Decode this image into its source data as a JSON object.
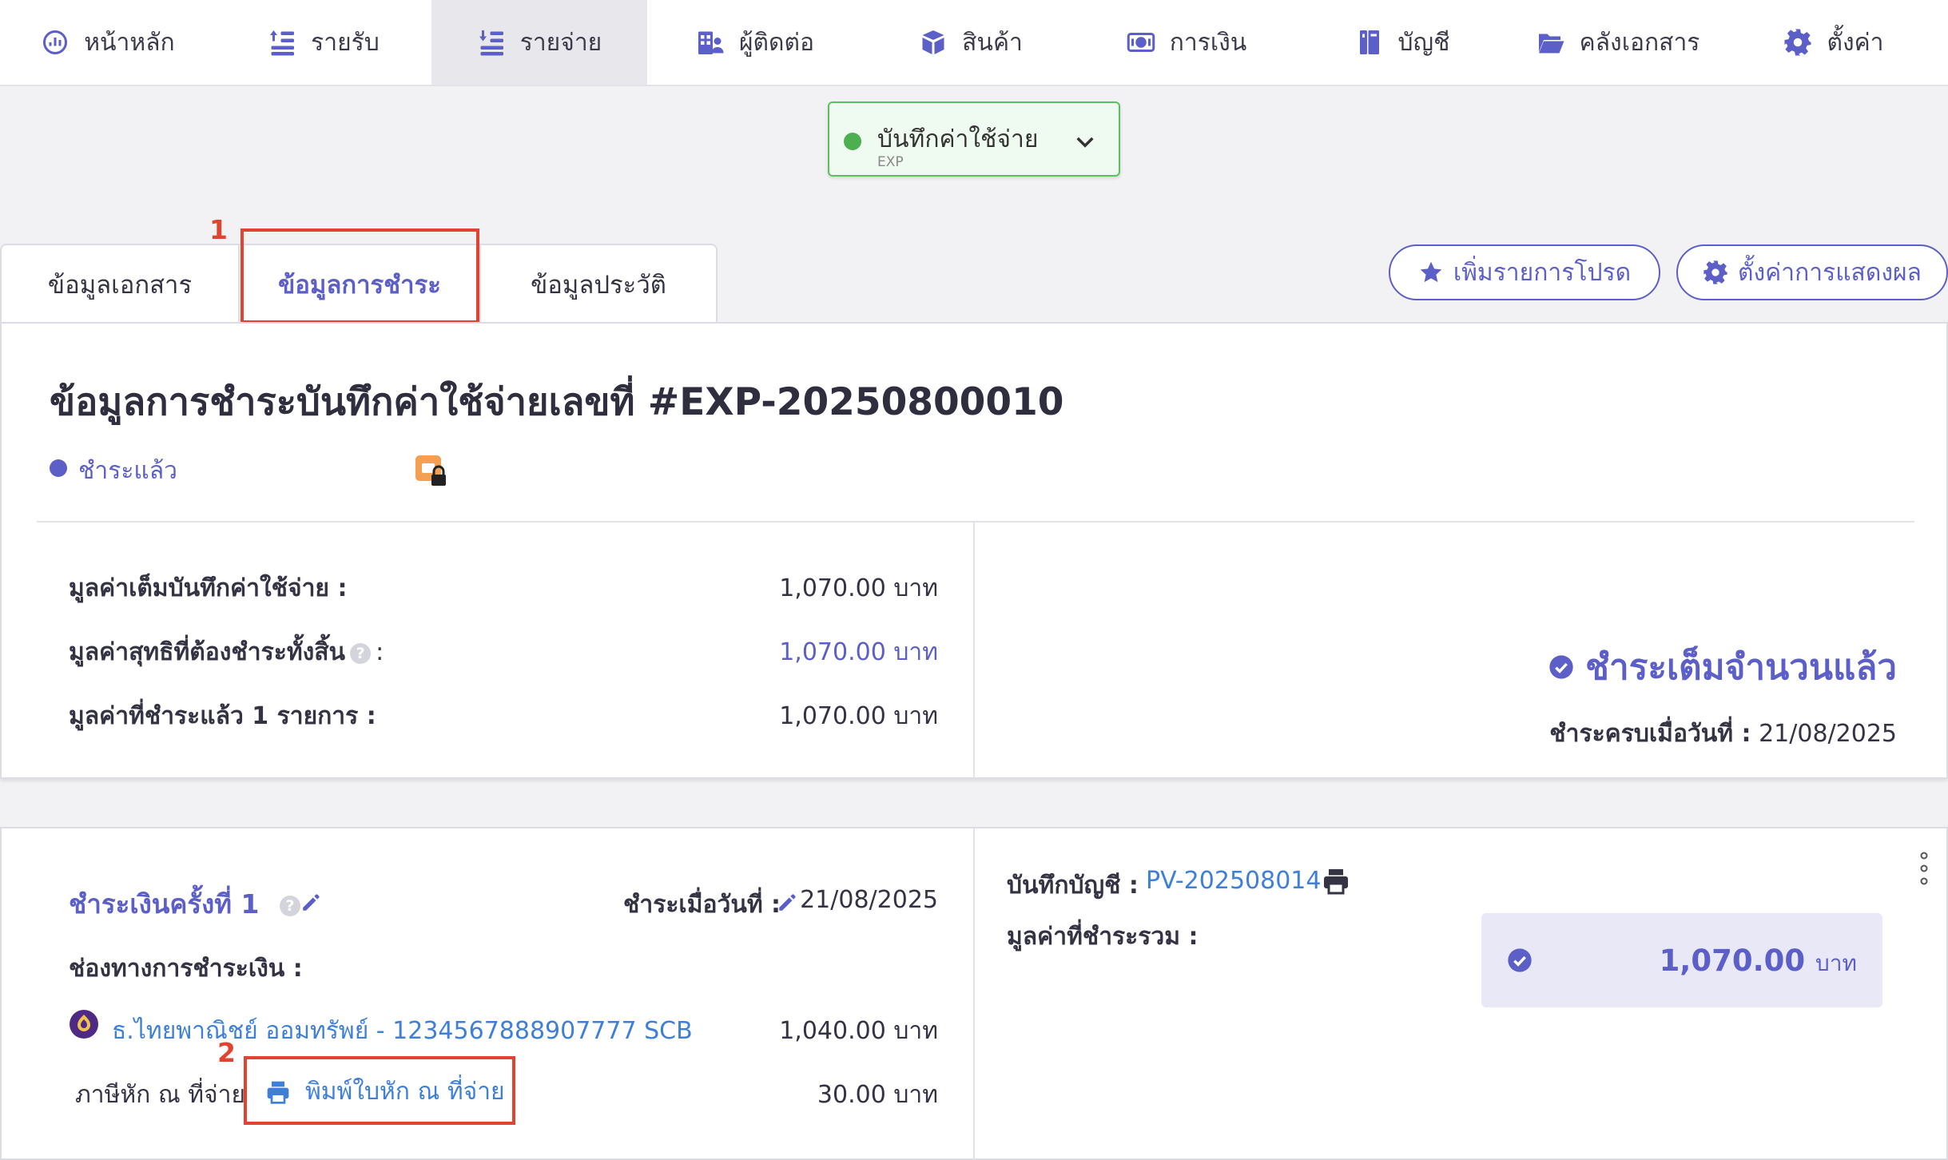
{
  "nav": {
    "items": [
      {
        "label": "หน้าหลัก",
        "icon": "dashboard-icon"
      },
      {
        "label": "รายรับ",
        "icon": "income-icon"
      },
      {
        "label": "รายจ่าย",
        "icon": "expense-icon"
      },
      {
        "label": "ผู้ติดต่อ",
        "icon": "contacts-icon"
      },
      {
        "label": "สินค้า",
        "icon": "product-box-icon"
      },
      {
        "label": "การเงิน",
        "icon": "money-icon"
      },
      {
        "label": "บัญชี",
        "icon": "ledger-book-icon"
      },
      {
        "label": "คลังเอกสาร",
        "icon": "folder-icon"
      },
      {
        "label": "ตั้งค่า",
        "icon": "gear-icon"
      }
    ],
    "active_index": 2
  },
  "doc_selector": {
    "title": "บันทึกค่าใช้จ่าย",
    "code": "EXP"
  },
  "tabs": [
    {
      "label": "ข้อมูลเอกสาร"
    },
    {
      "label": "ข้อมูลการชำระ"
    },
    {
      "label": "ข้อมูลประวัติ"
    }
  ],
  "annotations": {
    "step1": "1",
    "step2": "2",
    "highlight_color": "#e0432f"
  },
  "actions": {
    "favorite": "เพิ่มรายการโปรด",
    "display_settings": "ตั้งค่าการแสดงผล"
  },
  "summary": {
    "title": "ข้อมูลการชำระบันทึกค่าใช้จ่ายเลขที่ #EXP-20250800010",
    "status": "ชำระแล้ว",
    "rows": [
      {
        "label": "มูลค่าเต็มบันทึกค่าใช้จ่าย :",
        "value": "1,070.00 บาท"
      },
      {
        "label": "มูลค่าสุทธิที่ต้องชำระทั้งสิ้น",
        "help": "?",
        "suffix": ":",
        "value": "1,070.00 บาท"
      },
      {
        "label": "มูลค่าที่ชำระแล้ว 1 รายการ :",
        "value": "1,070.00 บาท"
      }
    ],
    "paid_full": "ชำระเต็มจำนวนแล้ว",
    "paid_date_label": "ชำระครบเมื่อวันที่ :",
    "paid_date": "21/08/2025"
  },
  "payment": {
    "title": "ชำระเงินครั้งที่ 1",
    "help": "?",
    "date_label": "ชำระเมื่อวันที่ :",
    "date": "21/08/2025",
    "channel_label": "ช่องทางการชำระเงิน :",
    "bank_account": "ธ.ไทยพาณิชย์ ออมทรัพย์ - 1234567888907777 SCB",
    "bank_amount": "1,040.00 บาท",
    "tax_label": "ภาษีหัก ณ ที่จ่าย",
    "print_wht": "พิมพ์ใบหัก ณ ที่จ่าย",
    "tax_amount": "30.00 บาท",
    "ledger_label": "บันทึกบัญชี :",
    "ledger_ref": "PV-202508014",
    "total_label": "มูลค่าที่ชำระรวม :",
    "total_amount": "1,070.00",
    "total_unit": "บาท"
  },
  "colors": {
    "accent": "#5b5fc7",
    "link": "#3d7fd9",
    "success": "#4caf50"
  }
}
